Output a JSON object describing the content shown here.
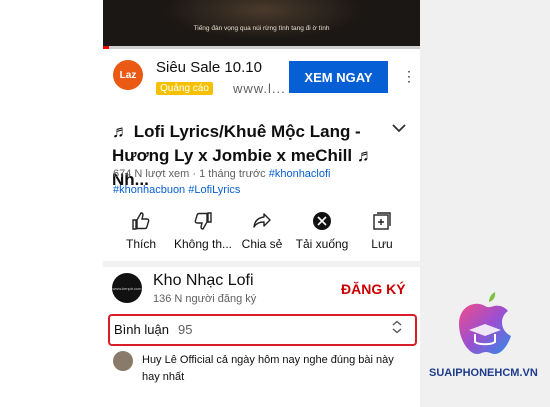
{
  "video": {
    "subtitle": "Tiếng đàn vọng qua núi rừng tình tang đi ờ tình",
    "progress_fraction": 0.02
  },
  "ad": {
    "logo_text": "Laz",
    "title": "Siêu Sale 10.10",
    "badge": "Quảng cáo",
    "url": "www.l...",
    "cta": "XEM NGAY",
    "more": "⋮"
  },
  "title": {
    "text": "♬ Lofi Lyrics/Khuê Mộc Lang - Hương Ly x Jombie x meChill ♬ Nh...",
    "chevron": "⌄"
  },
  "meta": {
    "views_time": "674 N lượt xem · 1 tháng trước ",
    "tag1": "#khonhaclofi",
    "tags_line": "#khonhacbuon #LofiLyrics"
  },
  "actions": [
    {
      "label": "Thích"
    },
    {
      "label": "Không th..."
    },
    {
      "label": "Chia sẻ"
    },
    {
      "label": "Tải xuống"
    },
    {
      "label": "Lưu"
    }
  ],
  "channel": {
    "avatar_text": "www.kenplr.com",
    "name": "Kho Nhạc Lofi",
    "subs": "136 N người đăng ký",
    "subscribe": "ĐĂNG KÝ"
  },
  "comments": {
    "label": "Bình luận",
    "count": "95",
    "toggle": "⌃⌄",
    "first": {
      "author": "Huy Lê Official",
      "text": "cả ngày hôm nay nghe đúng bài này hay nhất"
    }
  },
  "watermark": {
    "text": "SUAIPHONEHCM.VN"
  },
  "colors": {
    "accent_blue": "#065fd4",
    "subscribe_red": "#cc0000",
    "highlight_border": "#d71e28",
    "ad_badge": "#f6c000"
  }
}
